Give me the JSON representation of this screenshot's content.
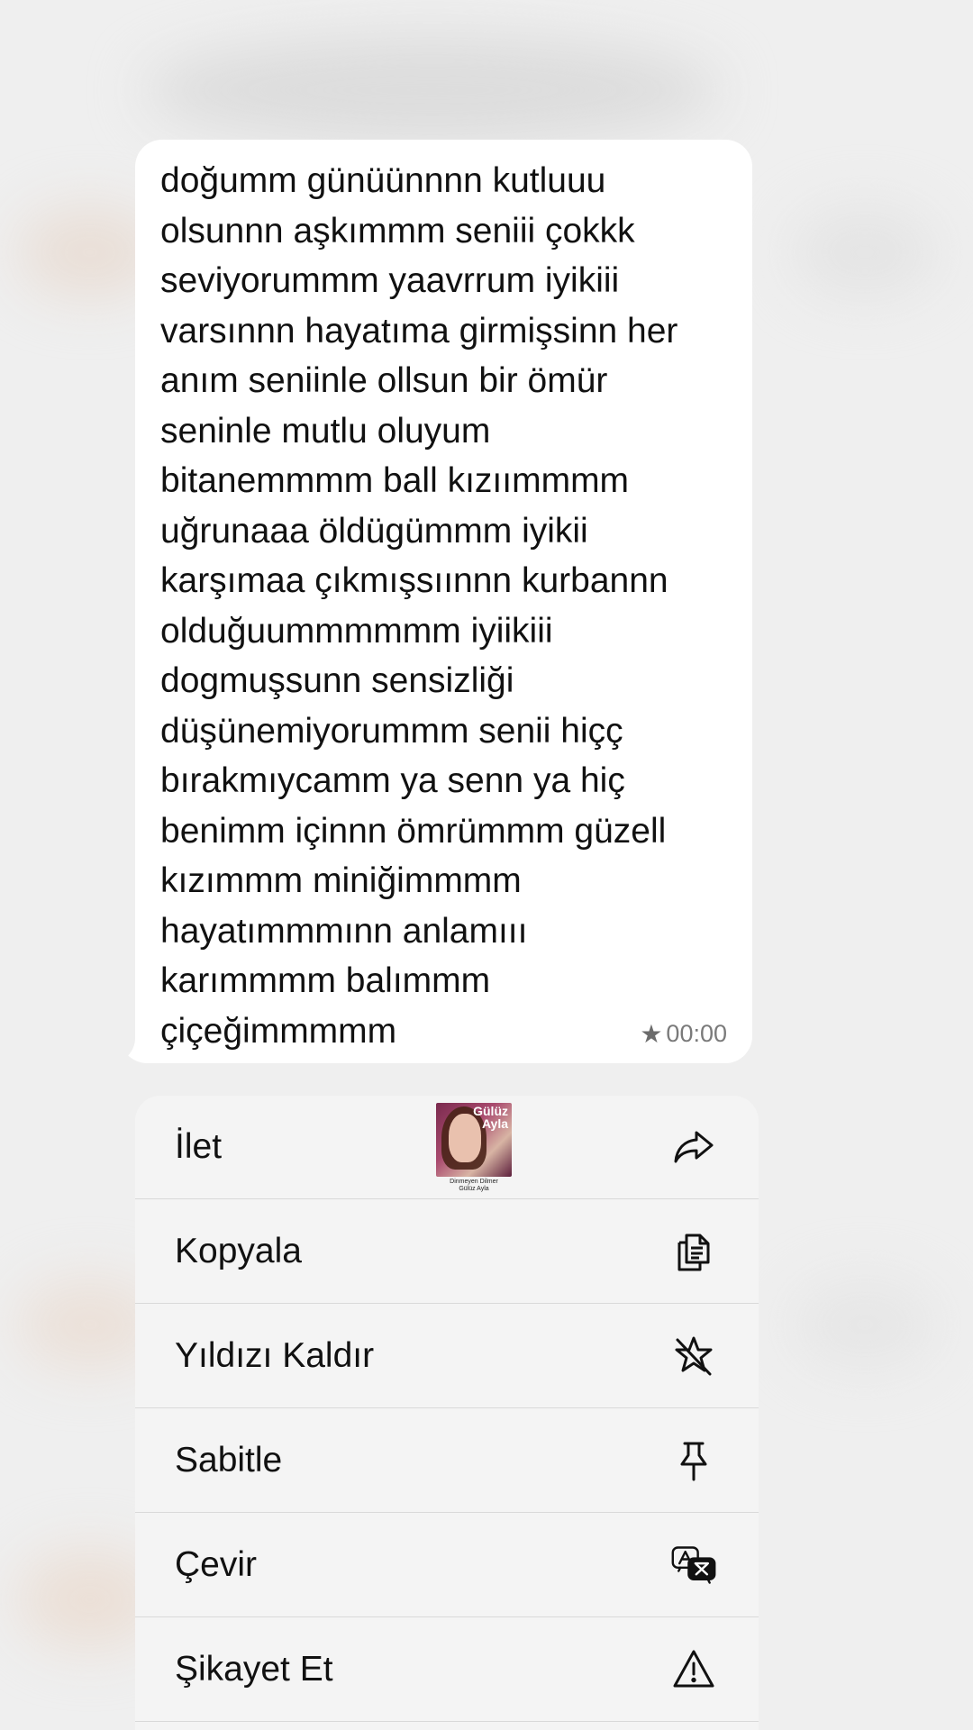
{
  "message": {
    "text": "doğumm günüünnnn kutluuu\nolsunnn aşkımmm seniii çokkk\nseviyorummm yaavrrum iyikiii\nvarsınnn hayatıma girmişsinn her\nanım seniinle ollsun bir ömür\nseninle mutlu oluyum\nbitanemmmm ball kızıımmmm\nuğrunaaa öldügümmm iyikii\nkarşımaa çıkmışsıınnn kurbannn\nolduğuummmmmm iyiikiii\ndogmuşsunn sensizliği\ndüşünemiyorummm senii hiçç\nbırakmıycamm ya senn ya hiç\nbenimm içinnn ömrümmm güzell\nkızımmm miniğimmmm\nhayatımmmınn anlamııı\nkarımmmm balımmm\nçiçeğimmmmm",
    "time": "00:00",
    "starred": true,
    "star_glyph": "★"
  },
  "menu": {
    "items": [
      {
        "label": "İlet",
        "icon": "forward-icon"
      },
      {
        "label": "Kopyala",
        "icon": "copy-icon"
      },
      {
        "label": "Yıldızı Kaldır",
        "icon": "unstar-icon"
      },
      {
        "label": "Sabitle",
        "icon": "pin-icon"
      },
      {
        "label": "Çevir",
        "icon": "translate-icon"
      },
      {
        "label": "Şikayet Et",
        "icon": "warning-icon"
      }
    ]
  },
  "sticker": {
    "title": "Gülüz\nAyla",
    "caption": "Dinmeyen Dilmer\nGülüz Ayla"
  },
  "colors": {
    "background": "#efefef",
    "bubble": "#ffffff",
    "menu": "#f4f4f4",
    "separator": "#d9d9d9",
    "time": "#7a7a7a"
  }
}
